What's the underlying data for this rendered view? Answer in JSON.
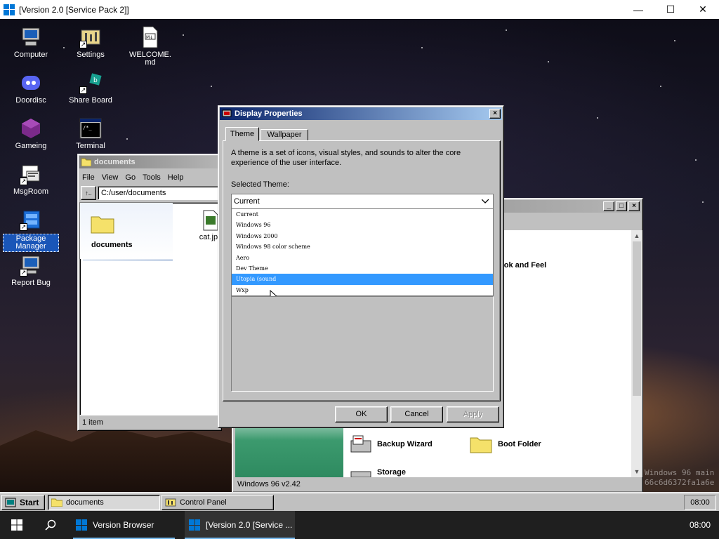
{
  "host_window": {
    "title": "[Version 2.0 [Service Pack 2]]",
    "minimize": "—",
    "maximize": "☐",
    "close": "✕"
  },
  "desktop_icons": [
    {
      "label": "Computer",
      "icon": "computer-icon"
    },
    {
      "label": "Settings",
      "icon": "settings-icon"
    },
    {
      "label": "WELCOME.md",
      "icon": "markdown-file-icon"
    },
    {
      "label": "Doordisc",
      "icon": "discord-icon"
    },
    {
      "label": "Share Board",
      "icon": "share-board-icon"
    },
    {
      "label": "Gameing",
      "icon": "game-icon"
    },
    {
      "label": "Terminal",
      "icon": "terminal-icon"
    },
    {
      "label": "MsgRoom",
      "icon": "msgroom-icon"
    },
    {
      "label": "Package Manager",
      "icon": "package-manager-icon"
    },
    {
      "label": "Report Bug",
      "icon": "report-bug-icon"
    }
  ],
  "watermark": {
    "line1": "Windows 96 main",
    "line2": "66c6d6372fa1a6e"
  },
  "explorer": {
    "title": "documents",
    "menu": [
      "File",
      "View",
      "Go",
      "Tools",
      "Help"
    ],
    "up_label": "↑..",
    "path": "C:/user/documents",
    "folder_heading": "documents",
    "file_name": "cat.jpg",
    "status": "1 item"
  },
  "control_panel": {
    "status": "Windows 96 v2.42",
    "section_title_partial": "ook and Feel",
    "items": [
      {
        "label": "Backup Wizard",
        "icon": "backup-wizard-icon"
      },
      {
        "label": "Boot Folder",
        "icon": "folder-icon"
      },
      {
        "label": "Storage",
        "icon": "storage-icon"
      }
    ]
  },
  "display_properties": {
    "title": "Display Properties",
    "tabs": [
      {
        "label": "Theme",
        "active": true
      },
      {
        "label": "Wallpaper",
        "active": false
      }
    ],
    "description": "A theme is a set of icons, visual styles, and sounds to alter the core experience of the user interface.",
    "selected_theme_label": "Selected Theme:",
    "selected_value": "Current",
    "options": [
      "Current",
      "Windows 96",
      "Windows 2000",
      "Windows 98 color scheme",
      "Aero",
      "Dev Theme",
      "Utopia (sound",
      "Wxp"
    ],
    "highlighted_index": 6,
    "ok": "OK",
    "cancel": "Cancel",
    "apply": "Apply"
  },
  "w96_taskbar": {
    "start": "Start",
    "tasks": [
      "documents",
      "Control Panel"
    ],
    "clock": "08:00"
  },
  "host_taskbar": {
    "apps": [
      {
        "label": "Version Browser",
        "active": false
      },
      {
        "label": "[Version 2.0 [Service ...",
        "active": true
      }
    ],
    "clock": "08:00"
  },
  "colors": {
    "title_active": "#0a246a",
    "title_active_end": "#a6caf0",
    "title_inactive": "#808080",
    "selection": "#3399ff",
    "host_accent": "#0078d7"
  }
}
